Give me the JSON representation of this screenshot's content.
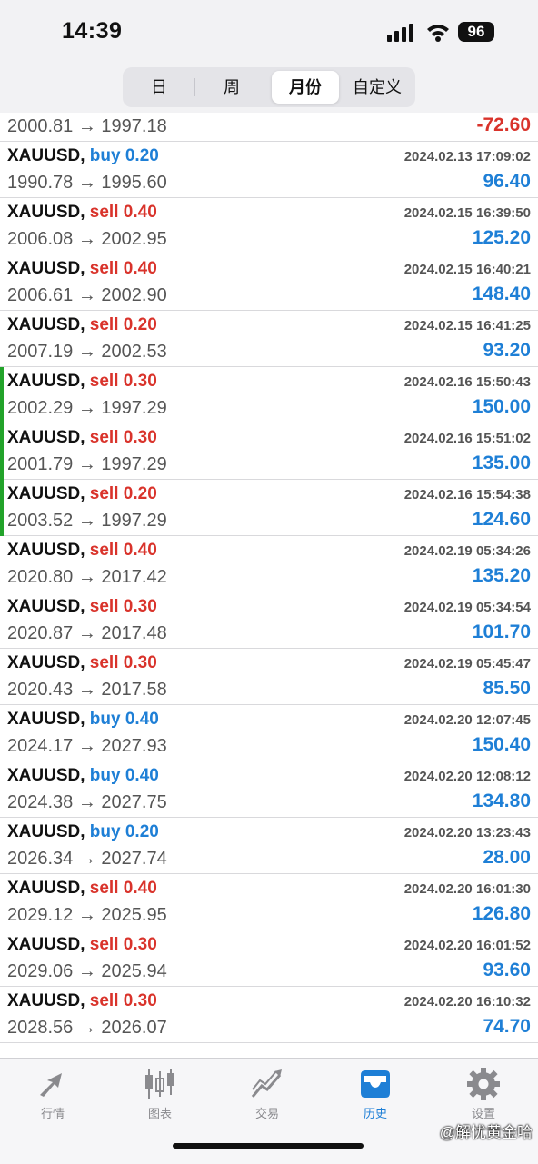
{
  "status_bar": {
    "time": "14:39",
    "battery": "96"
  },
  "segments": [
    {
      "label": "日",
      "active": false
    },
    {
      "label": "周",
      "active": false
    },
    {
      "label": "月份",
      "active": true
    },
    {
      "label": "自定义",
      "active": false
    }
  ],
  "partial_row": {
    "prices": "2000.81 → 1997.18",
    "profit": "-72.60"
  },
  "trades": [
    {
      "symbol": "XAUUSD,",
      "side": "buy",
      "volume": "0.20",
      "datetime": "2024.02.13 17:09:02",
      "prices": "1990.78 → 1995.60",
      "profit": "96.40",
      "marked": false
    },
    {
      "symbol": "XAUUSD,",
      "side": "sell",
      "volume": "0.40",
      "datetime": "2024.02.15 16:39:50",
      "prices": "2006.08 → 2002.95",
      "profit": "125.20",
      "marked": false
    },
    {
      "symbol": "XAUUSD,",
      "side": "sell",
      "volume": "0.40",
      "datetime": "2024.02.15 16:40:21",
      "prices": "2006.61 → 2002.90",
      "profit": "148.40",
      "marked": false
    },
    {
      "symbol": "XAUUSD,",
      "side": "sell",
      "volume": "0.20",
      "datetime": "2024.02.15 16:41:25",
      "prices": "2007.19 → 2002.53",
      "profit": "93.20",
      "marked": false
    },
    {
      "symbol": "XAUUSD,",
      "side": "sell",
      "volume": "0.30",
      "datetime": "2024.02.16 15:50:43",
      "prices": "2002.29 → 1997.29",
      "profit": "150.00",
      "marked": true
    },
    {
      "symbol": "XAUUSD,",
      "side": "sell",
      "volume": "0.30",
      "datetime": "2024.02.16 15:51:02",
      "prices": "2001.79 → 1997.29",
      "profit": "135.00",
      "marked": true
    },
    {
      "symbol": "XAUUSD,",
      "side": "sell",
      "volume": "0.20",
      "datetime": "2024.02.16 15:54:38",
      "prices": "2003.52 → 1997.29",
      "profit": "124.60",
      "marked": true
    },
    {
      "symbol": "XAUUSD,",
      "side": "sell",
      "volume": "0.40",
      "datetime": "2024.02.19 05:34:26",
      "prices": "2020.80 → 2017.42",
      "profit": "135.20",
      "marked": false
    },
    {
      "symbol": "XAUUSD,",
      "side": "sell",
      "volume": "0.30",
      "datetime": "2024.02.19 05:34:54",
      "prices": "2020.87 → 2017.48",
      "profit": "101.70",
      "marked": false
    },
    {
      "symbol": "XAUUSD,",
      "side": "sell",
      "volume": "0.30",
      "datetime": "2024.02.19 05:45:47",
      "prices": "2020.43 → 2017.58",
      "profit": "85.50",
      "marked": false
    },
    {
      "symbol": "XAUUSD,",
      "side": "buy",
      "volume": "0.40",
      "datetime": "2024.02.20 12:07:45",
      "prices": "2024.17 → 2027.93",
      "profit": "150.40",
      "marked": false
    },
    {
      "symbol": "XAUUSD,",
      "side": "buy",
      "volume": "0.40",
      "datetime": "2024.02.20 12:08:12",
      "prices": "2024.38 → 2027.75",
      "profit": "134.80",
      "marked": false
    },
    {
      "symbol": "XAUUSD,",
      "side": "buy",
      "volume": "0.20",
      "datetime": "2024.02.20 13:23:43",
      "prices": "2026.34 → 2027.74",
      "profit": "28.00",
      "marked": false
    },
    {
      "symbol": "XAUUSD,",
      "side": "sell",
      "volume": "0.40",
      "datetime": "2024.02.20 16:01:30",
      "prices": "2029.12 → 2025.95",
      "profit": "126.80",
      "marked": false
    },
    {
      "symbol": "XAUUSD,",
      "side": "sell",
      "volume": "0.30",
      "datetime": "2024.02.20 16:01:52",
      "prices": "2029.06 → 2025.94",
      "profit": "93.60",
      "marked": false
    },
    {
      "symbol": "XAUUSD,",
      "side": "sell",
      "volume": "0.30",
      "datetime": "2024.02.20 16:10:32",
      "prices": "2028.56 → 2026.07",
      "profit": "74.70",
      "marked": false
    }
  ],
  "tabs": [
    {
      "label": "行情",
      "icon": "quotes-icon",
      "active": false
    },
    {
      "label": "图表",
      "icon": "chart-icon",
      "active": false
    },
    {
      "label": "交易",
      "icon": "trade-icon",
      "active": false
    },
    {
      "label": "历史",
      "icon": "history-icon",
      "active": true
    },
    {
      "label": "设置",
      "icon": "settings-icon",
      "active": false
    }
  ],
  "watermark": "@解忧黄金哈",
  "colors": {
    "buy": "#1e7fd6",
    "sell": "#d9332b",
    "accent": "#1e7fd6",
    "marker": "#22a32a"
  }
}
